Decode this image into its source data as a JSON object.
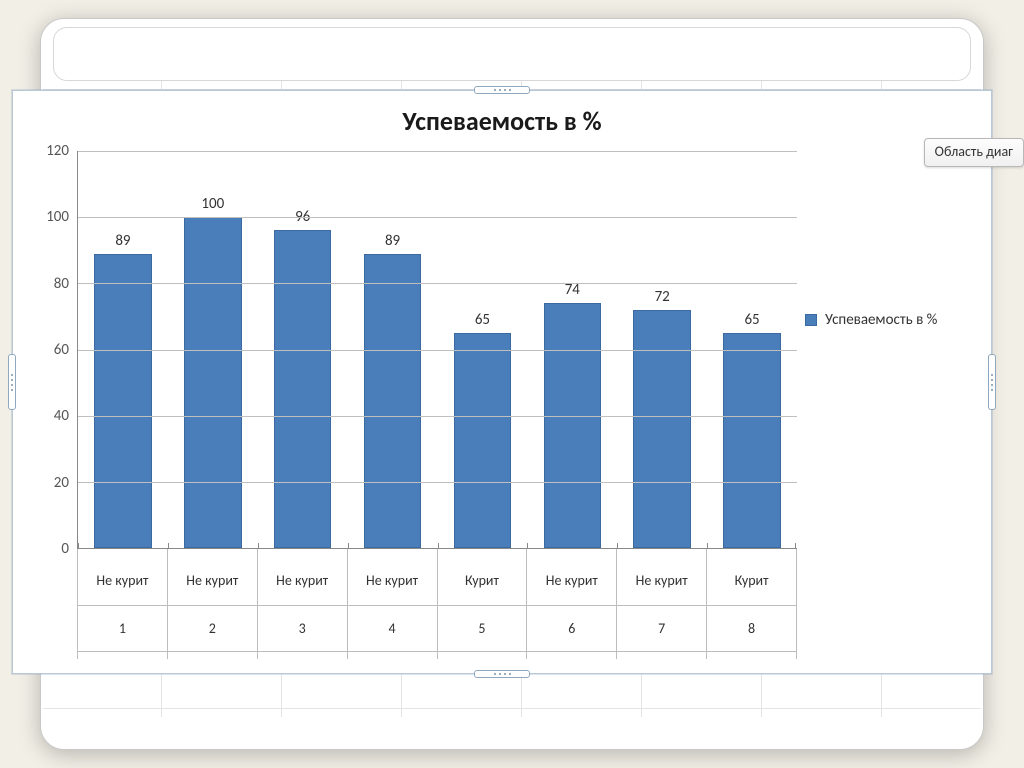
{
  "chart_data": {
    "type": "bar",
    "title": "Успеваемость в %",
    "ylabel": "",
    "xlabel": "",
    "ylim": [
      0,
      120
    ],
    "y_ticks": [
      0,
      20,
      40,
      60,
      80,
      100,
      120
    ],
    "categories_level1": [
      "Не курит",
      "Не курит",
      "Не курит",
      "Не курит",
      "Курит",
      "Не курит",
      "Не курит",
      "Курит"
    ],
    "categories_level2": [
      "1",
      "2",
      "3",
      "4",
      "5",
      "6",
      "7",
      "8"
    ],
    "series": [
      {
        "name": "Успеваемость в %",
        "values": [
          89,
          100,
          96,
          89,
          65,
          74,
          72,
          65
        ],
        "color": "#4a7ebb"
      }
    ],
    "data_labels": true,
    "legend_position": "right"
  },
  "legend": {
    "label": "Успеваемость в %"
  },
  "tooltip": {
    "text": "Область диаг"
  }
}
